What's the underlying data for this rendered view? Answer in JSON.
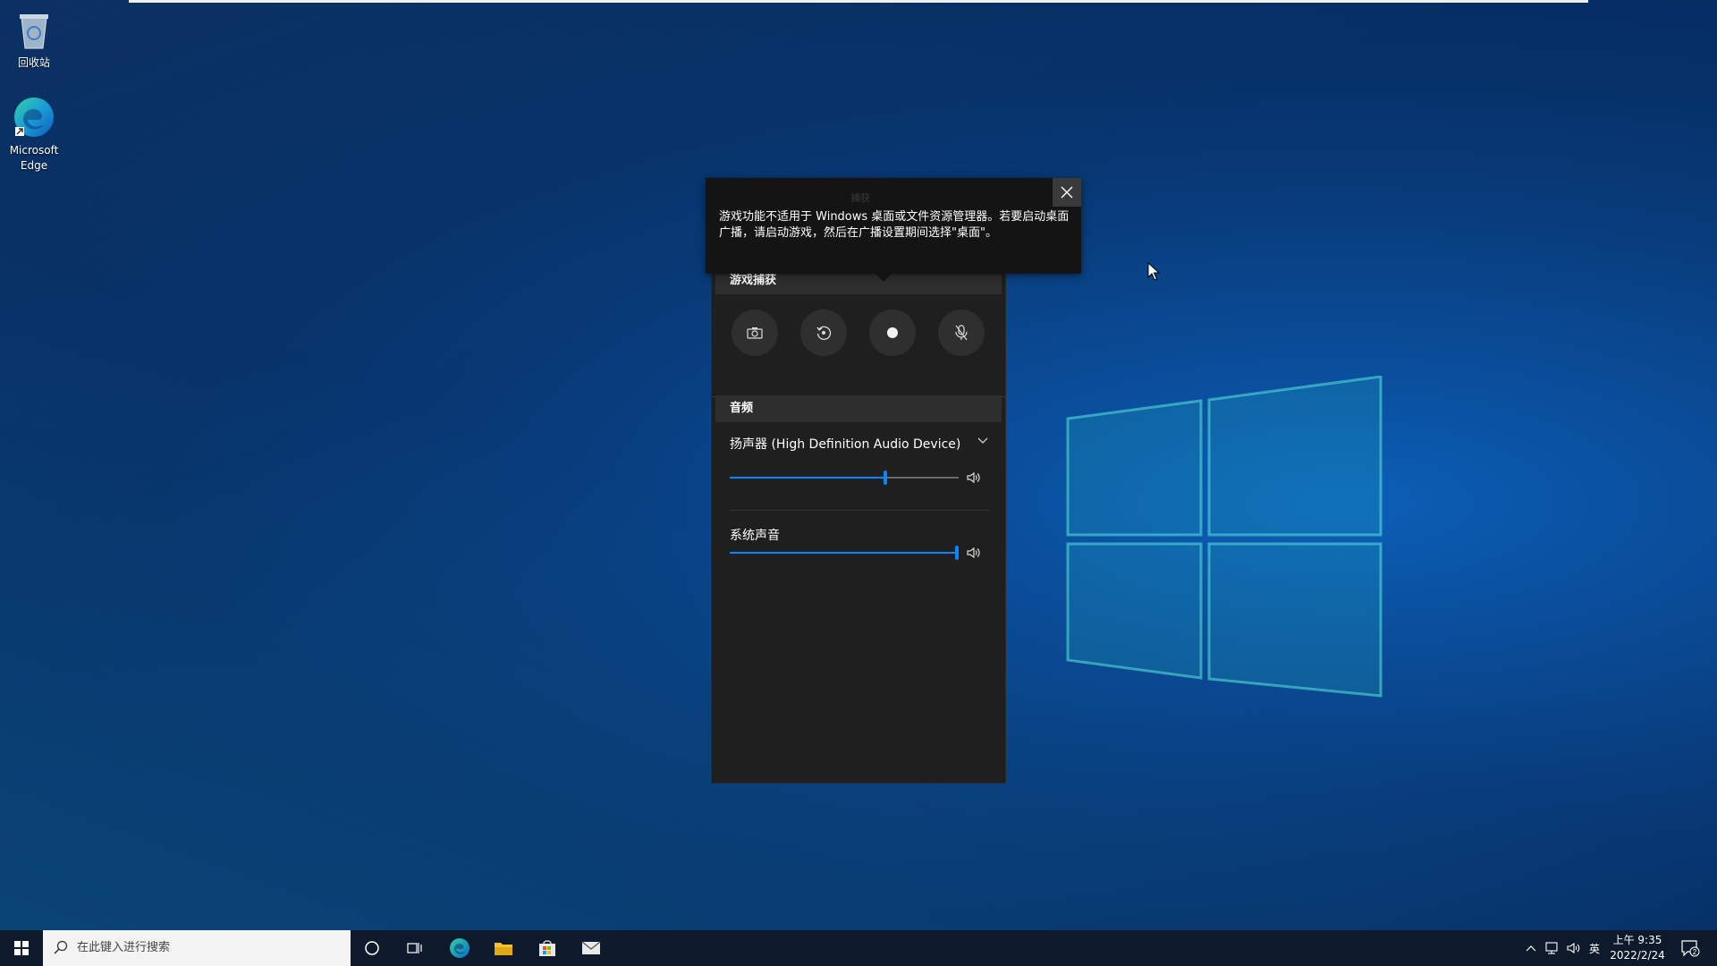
{
  "desktop": {
    "icons": [
      {
        "label": "回收站"
      },
      {
        "label_line1": "Microsoft",
        "label_line2": "Edge"
      }
    ]
  },
  "gamebar": {
    "tooltip": {
      "ghost_text": "捕获",
      "message": "游戏功能不适用于 Windows 桌面或文件资源管理器。若要启动桌面广播，请启动游戏，然后在广播设置期间选择\"桌面\"。"
    },
    "capture": {
      "title": "游戏捕获"
    },
    "audio": {
      "title": "音频",
      "device": "扬声器 (High Definition Audio Device)",
      "device_volume": 0.67,
      "system_label": "系统声音",
      "system_volume": 1.0
    }
  },
  "taskbar": {
    "search_placeholder": "在此键入进行搜索",
    "ime": "英",
    "time": "上午 9:35",
    "date": "2022/2/24",
    "notifications": "2"
  },
  "colors": {
    "accent": "#0a84ff",
    "panel_bg": "#1f1f1f",
    "section_bg": "#2e2e2e"
  }
}
